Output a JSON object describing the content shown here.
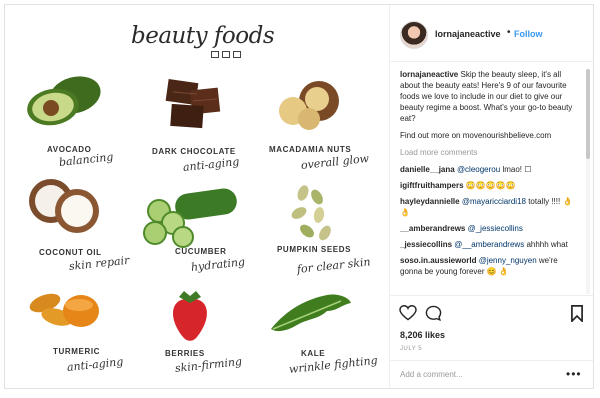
{
  "poster": {
    "title": "beauty foods",
    "foods": [
      {
        "name": "AVOCADO",
        "benefit": "balancing",
        "icon": "avocado-icon"
      },
      {
        "name": "DARK CHOCOLATE",
        "benefit": "anti-aging",
        "icon": "chocolate-icon"
      },
      {
        "name": "MACADAMIA NUTS",
        "benefit": "overall glow",
        "icon": "macadamia-icon"
      },
      {
        "name": "COCONUT OIL",
        "benefit": "skin repair",
        "icon": "coconut-icon"
      },
      {
        "name": "CUCUMBER",
        "benefit": "hydrating",
        "icon": "cucumber-icon"
      },
      {
        "name": "PUMPKIN SEEDS",
        "benefit": "for clear skin",
        "icon": "pumpkin-seeds-icon"
      },
      {
        "name": "TURMERIC",
        "benefit": "anti-aging",
        "icon": "turmeric-icon"
      },
      {
        "name": "BERRIES",
        "benefit": "skin-firming",
        "icon": "strawberry-icon"
      },
      {
        "name": "KALE",
        "benefit": "wrinkle fighting",
        "icon": "kale-icon"
      }
    ]
  },
  "header": {
    "username": "lornajaneactive",
    "separator": "•",
    "follow_label": "Follow"
  },
  "caption": {
    "username": "lornajaneactive",
    "text": "Skip the beauty sleep, it's all about the beauty eats! Here's 9 of our favourite foods we love to include in our diet to give our beauty regime a boost. What's your go-to beauty eat?",
    "find_out": "Find out more on movenourishbelieve.com"
  },
  "load_more_label": "Load more comments",
  "comments": [
    {
      "user": "danielle__jana",
      "mention": "@cleogerou",
      "text": "lmao! ☐"
    },
    {
      "user": "igiftfruithampers",
      "mention": "",
      "text": "😳😳😳😳😳"
    },
    {
      "user": "hayleydannielle",
      "mention": "@mayaricciardi18",
      "text": "totally !!!! 👌👌"
    },
    {
      "user": "__amberandrews",
      "mention": "@_jessiecollins",
      "text": ""
    },
    {
      "user": "_jessiecollins",
      "mention": "@__amberandrews",
      "text": "ahhhh what"
    },
    {
      "user": "soso.in.aussieworld",
      "mention": "@jenny_nguyen",
      "text": "we're gonna be young forever 😊 👌"
    }
  ],
  "likes": "8,206 likes",
  "date": "JULY 5",
  "add_comment_placeholder": "Add a comment...",
  "more_label": "•••",
  "colors": {
    "link": "#3897f0",
    "mention": "#003569",
    "muted": "#999999"
  }
}
